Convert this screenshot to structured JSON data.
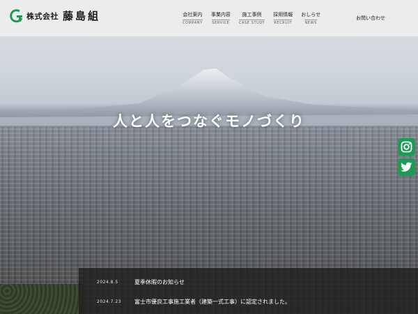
{
  "header": {
    "company_prefix": "株式会社",
    "company_name": "藤島組",
    "nav": [
      {
        "jp": "会社案内",
        "en": "COMPANY"
      },
      {
        "jp": "事業内容",
        "en": "SERVICE"
      },
      {
        "jp": "施工事例",
        "en": "CASE STUDY"
      },
      {
        "jp": "採用情報",
        "en": "RECRUIT"
      },
      {
        "jp": "おしらせ",
        "en": "NEWS"
      }
    ],
    "contact": "お問い合わせ"
  },
  "hero": {
    "tagline": "人と人をつなぐモノづくり"
  },
  "social": {
    "instagram_icon": "instagram-icon",
    "twitter_icon": "twitter-icon",
    "color": "#1b9b56"
  },
  "news": [
    {
      "date": "2024.8.5",
      "title": "夏季休暇のお知らせ"
    },
    {
      "date": "2024.7.23",
      "title": "富士市優良工事施工業者（建築一式工事）に認定されました。"
    }
  ],
  "colors": {
    "brand_green": "#1b9b56",
    "header_bg": "#ececec"
  }
}
